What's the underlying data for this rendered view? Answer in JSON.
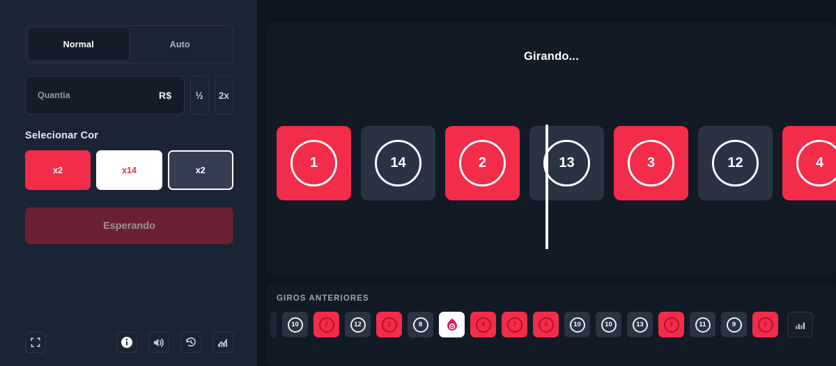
{
  "theme": {
    "page_bg": "#0E1520",
    "sidebar_bg": "#1B2434",
    "panel_bg": "#121A26",
    "accent_red": "#F22C49",
    "tile_dark": "#2A3244",
    "disabled_red": "#6B2134"
  },
  "sidebar": {
    "mode_tabs": [
      {
        "label": "Normal",
        "active": true
      },
      {
        "label": "Auto",
        "active": false
      }
    ],
    "amount": {
      "placeholder": "Quantia",
      "value": "",
      "currency": "R$",
      "half_label": "½",
      "double_label": "2x"
    },
    "color_section_title": "Selecionar Cor",
    "color_options": [
      {
        "label": "x2",
        "style": "red",
        "selected": false
      },
      {
        "label": "x14",
        "style": "white",
        "selected": false
      },
      {
        "label": "x2",
        "style": "dark",
        "selected": true
      }
    ],
    "bet_button": {
      "label": "Esperando",
      "disabled": true
    },
    "footer_icons": [
      {
        "name": "fullscreen-icon"
      },
      {
        "name": "info-icon"
      },
      {
        "name": "volume-icon"
      },
      {
        "name": "history-icon"
      },
      {
        "name": "stats-icon"
      }
    ]
  },
  "main": {
    "spin": {
      "status": "Girando...",
      "marker_visible": true,
      "tiles": [
        {
          "number": "",
          "color": "red",
          "partial": true
        },
        {
          "number": "1",
          "color": "red"
        },
        {
          "number": "14",
          "color": "dark"
        },
        {
          "number": "2",
          "color": "red"
        },
        {
          "number": "13",
          "color": "dark"
        },
        {
          "number": "3",
          "color": "red"
        },
        {
          "number": "12",
          "color": "dark"
        },
        {
          "number": "4",
          "color": "red"
        }
      ]
    },
    "history": {
      "title": "GIROS ANTERIORES",
      "items": [
        {
          "kind": "sliver",
          "color": "dark",
          "label": ""
        },
        {
          "kind": "number",
          "color": "dark",
          "label": "10"
        },
        {
          "kind": "number",
          "color": "red",
          "label": "7"
        },
        {
          "kind": "number",
          "color": "dark",
          "label": "12"
        },
        {
          "kind": "number",
          "color": "red",
          "label": "3"
        },
        {
          "kind": "number",
          "color": "dark",
          "label": "8"
        },
        {
          "kind": "bonus",
          "color": "white",
          "label": ""
        },
        {
          "kind": "number",
          "color": "red",
          "label": "4"
        },
        {
          "kind": "number",
          "color": "red",
          "label": "7"
        },
        {
          "kind": "number",
          "color": "red",
          "label": "4"
        },
        {
          "kind": "number",
          "color": "dark",
          "label": "10"
        },
        {
          "kind": "number",
          "color": "dark",
          "label": "10"
        },
        {
          "kind": "number",
          "color": "dark",
          "label": "13"
        },
        {
          "kind": "number",
          "color": "red",
          "label": "7"
        },
        {
          "kind": "number",
          "color": "dark",
          "label": "11"
        },
        {
          "kind": "number",
          "color": "dark",
          "label": "9"
        },
        {
          "kind": "number",
          "color": "red",
          "label": "3"
        }
      ],
      "chart_button": "stats-icon"
    }
  }
}
